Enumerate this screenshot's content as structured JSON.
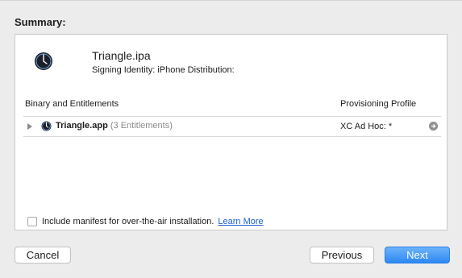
{
  "summary": {
    "heading": "Summary:",
    "app_name": "Triangle.ipa",
    "signing_identity": "Signing Identity: iPhone Distribution:",
    "app_icon": "triangle-app-icon"
  },
  "table": {
    "columns": [
      "Binary and Entitlements",
      "Provisioning Profile"
    ],
    "rows": [
      {
        "name": "Triangle.app",
        "entitlements": "(3 Entitlements)",
        "profile": "XC Ad Hoc: *",
        "icon": "triangle-app-icon"
      }
    ]
  },
  "manifest": {
    "label": "Include manifest for over-the-air installation.",
    "link": "Learn More",
    "checked": false
  },
  "buttons": {
    "cancel": "Cancel",
    "previous": "Previous",
    "next": "Next"
  },
  "colors": {
    "accent": "#2d88f3",
    "link": "#1a5fd1",
    "background": "#ececec"
  }
}
